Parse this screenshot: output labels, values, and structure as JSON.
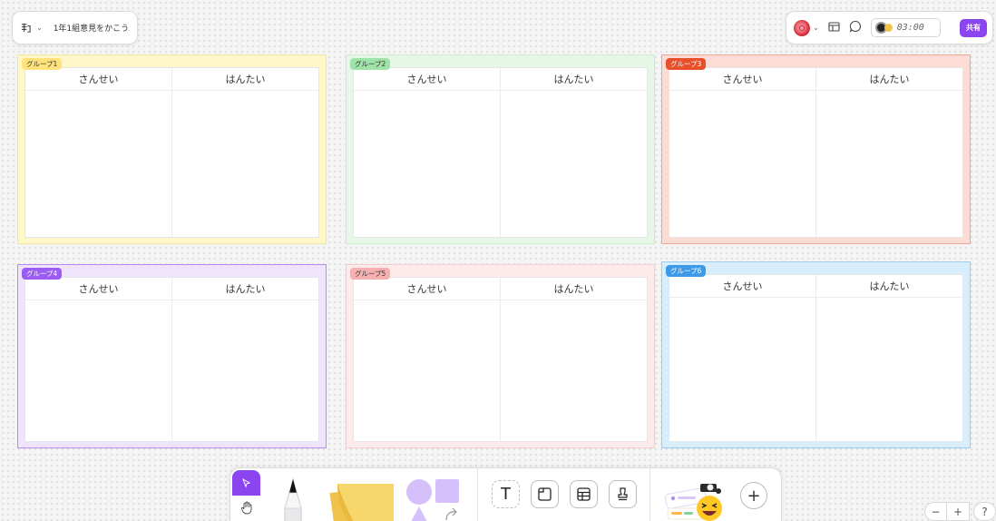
{
  "document": {
    "title": "1年1組意見をかこう"
  },
  "timer": "03:00",
  "share_label": "共有",
  "columns": {
    "left": "さんせい",
    "right": "はんたい"
  },
  "groups": [
    {
      "label": "グループ1",
      "color": "#fff7c8",
      "label_bg": "#ffe27a",
      "label_fg": "#333333"
    },
    {
      "label": "グループ2",
      "color": "#e6f7e8",
      "label_bg": "#9fe3a9",
      "label_fg": "#333333"
    },
    {
      "label": "グループ3",
      "color": "#fcdcd5",
      "label_bg": "#e8502a",
      "label_fg": "#ffffff"
    },
    {
      "label": "グループ4",
      "color": "#f0e3fc",
      "label_bg": "#9a5cf2",
      "label_fg": "#ffffff"
    },
    {
      "label": "グループ5",
      "color": "#fdeaea",
      "label_bg": "#f7b0b0",
      "label_fg": "#333333"
    },
    {
      "label": "グループ6",
      "color": "#d9eefc",
      "label_bg": "#3d9ae8",
      "label_fg": "#ffffff"
    }
  ],
  "zoom_controls": {
    "out": "−",
    "in": "+",
    "help": "?"
  },
  "toolbar": {
    "add": "+",
    "text_tool": "T"
  },
  "colors": {
    "accent": "#8b45ef"
  }
}
